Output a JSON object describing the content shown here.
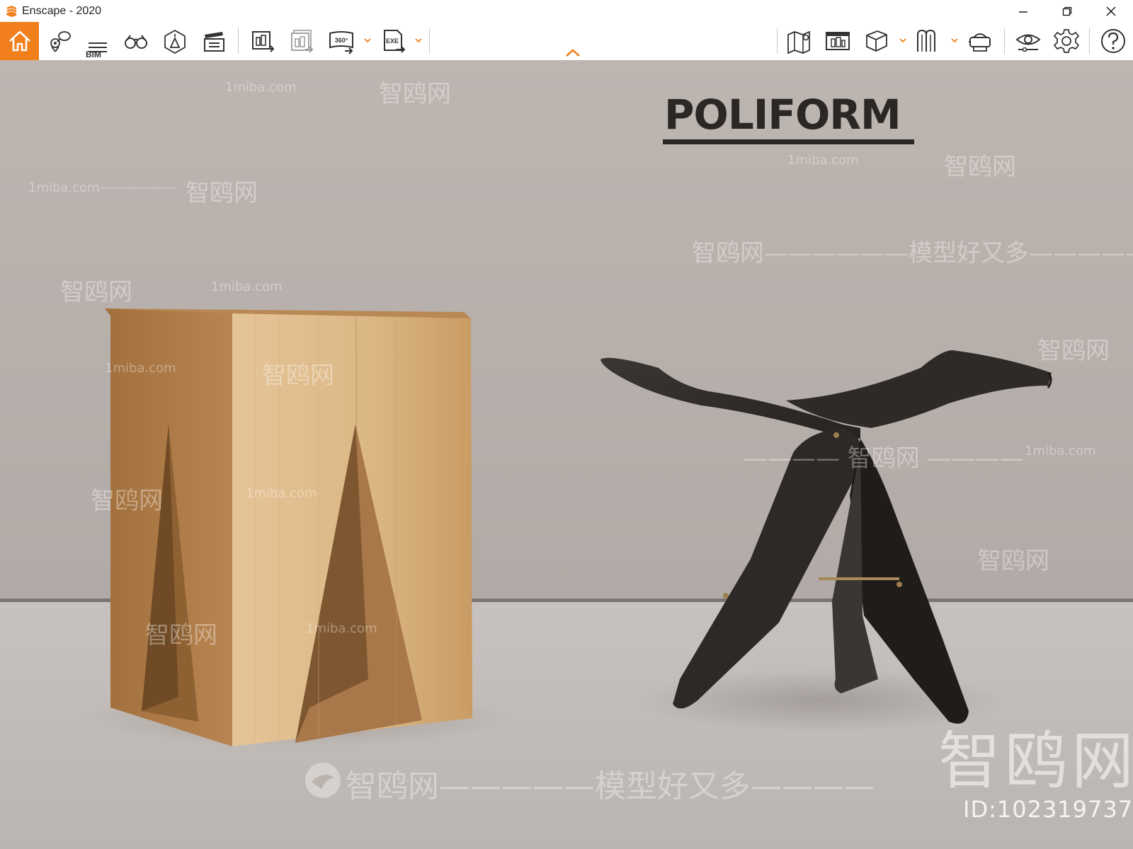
{
  "window": {
    "title": "Enscape - 2020",
    "controls": {
      "minimize": "—",
      "restore": "❐",
      "close": "✕"
    }
  },
  "toolbar": {
    "accent_color": "#f07f1c",
    "left_buttons": [
      {
        "name": "home-icon"
      },
      {
        "name": "views-icon"
      },
      {
        "name": "bim-icon",
        "label": "BIM"
      },
      {
        "name": "binoculars-icon"
      },
      {
        "name": "atmosphere-icon"
      },
      {
        "name": "video-editor-icon"
      },
      {
        "name": "render-image-icon"
      },
      {
        "name": "batch-render-icon"
      },
      {
        "name": "panorama-360-icon",
        "label": "360°"
      },
      {
        "name": "export-exe-icon",
        "label": "EXE"
      }
    ],
    "right_buttons": [
      {
        "name": "map-icon"
      },
      {
        "name": "render-gallery-icon"
      },
      {
        "name": "asset-library-icon"
      },
      {
        "name": "material-icon"
      },
      {
        "name": "vr-headset-icon"
      },
      {
        "name": "visual-settings-icon"
      },
      {
        "name": "settings-gear-icon"
      },
      {
        "name": "help-icon"
      }
    ]
  },
  "scene": {
    "brand_text": "POLIFORM",
    "watermarks": {
      "site": "1miba.com",
      "site_dashes": "1miba.com——————",
      "cn_brand": "智鸥网",
      "cn_dashes": "———— 智鸥网 ————",
      "cn_slogan": "智鸥网——————模型好又多——————",
      "cn_slogan_bottom": "智鸥网—————模型好又多————",
      "big": "智鸥网",
      "id": "ID:102319737"
    }
  }
}
